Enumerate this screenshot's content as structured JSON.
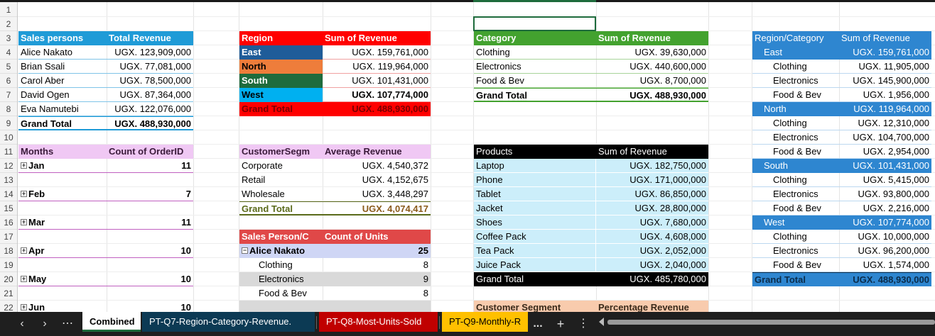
{
  "row_numbers": [
    "1",
    "2",
    "3",
    "4",
    "5",
    "6",
    "7",
    "8",
    "9",
    "10",
    "11",
    "12",
    "13",
    "14",
    "15",
    "16",
    "17",
    "18",
    "19",
    "20",
    "21",
    "22"
  ],
  "colors": {
    "sales_header": "#1f9bd7",
    "region_header": "#ff0000",
    "category_header": "#43a22f",
    "regcat_header": "#2e86d0",
    "months_header": "#f0c8f4",
    "segment_header": "#f0c8f4",
    "units_header": "#e04848",
    "products_header": "#000000",
    "products_body": "#cceefa",
    "east": "#1f5c99",
    "north": "#ee7d3b",
    "south": "#1e6b3c",
    "west": "#00b0f0"
  },
  "sales": {
    "col1": "Sales persons",
    "col2": "Total Revenue",
    "rows": [
      {
        "name": "Alice Nakato",
        "value": "UGX. 123,909,000"
      },
      {
        "name": "Brian Ssali",
        "value": "UGX. 77,081,000"
      },
      {
        "name": "Carol Aber",
        "value": "UGX. 78,500,000"
      },
      {
        "name": "David Ogen",
        "value": "UGX. 87,364,000"
      },
      {
        "name": "Eva Namutebi",
        "value": "UGX. 122,076,000"
      }
    ],
    "total_label": "Grand Total",
    "total_value": "UGX. 488,930,000"
  },
  "months": {
    "col1": "Months",
    "col2": "Count of OrderID",
    "rows": [
      {
        "name": "Jan",
        "value": "11"
      },
      {
        "name": "Feb",
        "value": "7"
      },
      {
        "name": "Mar",
        "value": "11"
      },
      {
        "name": "Apr",
        "value": "10"
      },
      {
        "name": "May",
        "value": "10"
      },
      {
        "name": "Jun",
        "value": "10"
      }
    ]
  },
  "region": {
    "col1": "Region",
    "col2": "Sum of Revenue",
    "rows": [
      {
        "name": "East",
        "value": "UGX. 159,761,000"
      },
      {
        "name": "North",
        "value": "UGX. 119,964,000"
      },
      {
        "name": "South",
        "value": "UGX. 101,431,000"
      },
      {
        "name": "West",
        "value": "UGX. 107,774,000"
      }
    ],
    "total_label": "Grand Total",
    "total_value": "UGX. 488,930,000"
  },
  "segment_avg": {
    "col1": "CustomerSegm",
    "col2": "Average Revenue",
    "rows": [
      {
        "name": "Corporate",
        "value": "UGX. 4,540,372"
      },
      {
        "name": "Retail",
        "value": "UGX. 4,152,675"
      },
      {
        "name": "Wholesale",
        "value": "UGX. 3,448,297"
      }
    ],
    "total_label": "Grand Total",
    "total_value": "UGX. 4,074,417"
  },
  "units": {
    "col1": "Sales Person/C",
    "col2": "Count of Units",
    "person": "Alice Nakato",
    "person_value": "25",
    "rows": [
      {
        "name": "Clothing",
        "value": "8"
      },
      {
        "name": "Electronics",
        "value": "9"
      },
      {
        "name": "Food & Bev",
        "value": "8"
      }
    ]
  },
  "category": {
    "col1": "Category",
    "col2": "Sum of Revenue",
    "rows": [
      {
        "name": "Clothing",
        "value": "UGX. 39,630,000"
      },
      {
        "name": "Electronics",
        "value": "UGX. 440,600,000"
      },
      {
        "name": "Food & Bev",
        "value": "UGX. 8,700,000"
      }
    ],
    "total_label": "Grand Total",
    "total_value": "UGX. 488,930,000"
  },
  "products": {
    "col1": "Products",
    "col2": "Sum of Revenue",
    "rows": [
      {
        "name": "Laptop",
        "value": "UGX. 182,750,000"
      },
      {
        "name": "Phone",
        "value": "UGX. 171,000,000"
      },
      {
        "name": "Tablet",
        "value": "UGX. 86,850,000"
      },
      {
        "name": "Jacket",
        "value": "UGX. 28,800,000"
      },
      {
        "name": "Shoes",
        "value": "UGX. 7,680,000"
      },
      {
        "name": "Coffee Pack",
        "value": "UGX. 4,608,000"
      },
      {
        "name": "Tea Pack",
        "value": "UGX. 2,052,000"
      },
      {
        "name": "Juice Pack",
        "value": "UGX. 2,040,000"
      }
    ],
    "total_label": "Grand Total",
    "total_value": "UGX. 485,780,000"
  },
  "segment_pct": {
    "col1": "Customer Segment",
    "col2": "Percentage Revenue"
  },
  "regcat": {
    "col1": "Region/Category",
    "col2": "Sum of Revenue",
    "rows": [
      {
        "name": "East",
        "value": "UGX. 159,761,000",
        "type": "region"
      },
      {
        "name": "Clothing",
        "value": "UGX. 11,905,000",
        "type": "item"
      },
      {
        "name": "Electronics",
        "value": "UGX. 145,900,000",
        "type": "item"
      },
      {
        "name": "Food & Bev",
        "value": "UGX. 1,956,000",
        "type": "item"
      },
      {
        "name": "North",
        "value": "UGX. 119,964,000",
        "type": "region"
      },
      {
        "name": "Clothing",
        "value": "UGX. 12,310,000",
        "type": "item"
      },
      {
        "name": "Electronics",
        "value": "UGX. 104,700,000",
        "type": "item"
      },
      {
        "name": "Food & Bev",
        "value": "UGX. 2,954,000",
        "type": "item"
      },
      {
        "name": "South",
        "value": "UGX. 101,431,000",
        "type": "region"
      },
      {
        "name": "Clothing",
        "value": "UGX. 5,415,000",
        "type": "item"
      },
      {
        "name": "Electronics",
        "value": "UGX. 93,800,000",
        "type": "item"
      },
      {
        "name": "Food & Bev",
        "value": "UGX. 2,216,000",
        "type": "item"
      },
      {
        "name": "West",
        "value": "UGX. 107,774,000",
        "type": "region"
      },
      {
        "name": "Clothing",
        "value": "UGX. 10,000,000",
        "type": "item"
      },
      {
        "name": "Electronics",
        "value": "UGX. 96,200,000",
        "type": "item"
      },
      {
        "name": "Food & Bev",
        "value": "UGX. 1,574,000",
        "type": "item"
      }
    ],
    "total_label": "Grand Total",
    "total_value": "UGX. 488,930,000"
  },
  "tabs": {
    "combined": "Combined",
    "q7": "PT-Q7-Region-Category-Revenue.",
    "q8": "PT-Q8-Most-Units-Sold",
    "q9": "PT-Q9-Monthly-R",
    "more": "...",
    "add": "+",
    "menu": "⋮"
  },
  "nav": {
    "prev": "‹",
    "next": "›",
    "more": "⋯"
  }
}
